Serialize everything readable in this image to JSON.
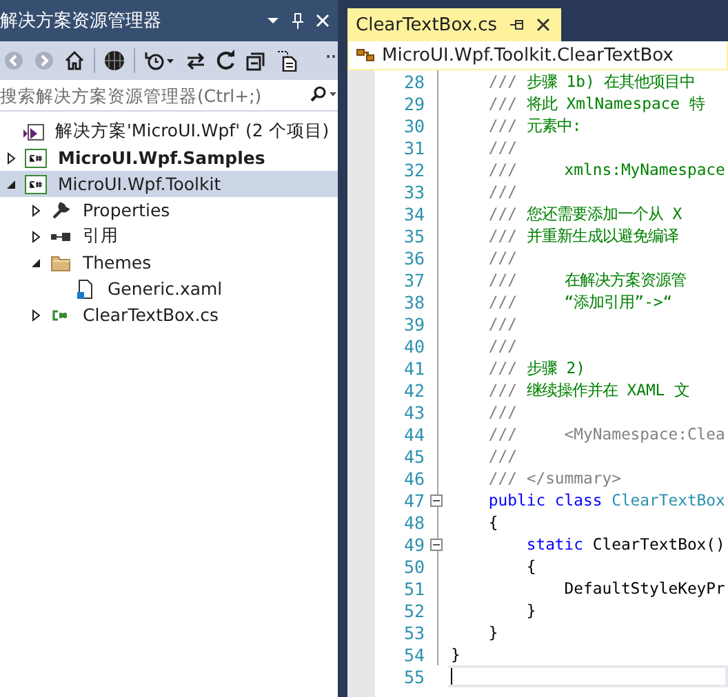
{
  "explorer": {
    "title": "解决方案资源管理器",
    "toolbar": [
      {
        "kind": "back",
        "disabled": true
      },
      {
        "kind": "forward",
        "disabled": true
      },
      {
        "kind": "home",
        "disabled": false
      },
      {
        "kind": "globe",
        "disabled": false
      },
      {
        "kind": "history",
        "disabled": false
      },
      {
        "kind": "sync",
        "disabled": false
      },
      {
        "kind": "refresh",
        "disabled": false
      },
      {
        "kind": "collapse",
        "disabled": false
      },
      {
        "kind": "files",
        "disabled": false
      }
    ],
    "search": {
      "placeholder": "搜索解决方案资源管理器(Ctrl+;)"
    },
    "tree": [
      {
        "kind": "solution",
        "label": "解决方案'MicroUI.Wpf' (2 个项目)",
        "selected": false,
        "children": [
          {
            "kind": "project",
            "label": "MicroUI.Wpf.Samples",
            "startup": true,
            "expanded": false,
            "selected": false
          },
          {
            "kind": "project",
            "label": "MicroUI.Wpf.Toolkit",
            "startup": false,
            "expanded": true,
            "selected": true,
            "children": [
              {
                "kind": "properties",
                "label": "Properties",
                "expanded": false,
                "selected": false
              },
              {
                "kind": "references",
                "label": "引用",
                "expanded": false,
                "selected": false
              },
              {
                "kind": "folder",
                "label": "Themes",
                "expanded": true,
                "selected": false,
                "children": [
                  {
                    "kind": "xaml",
                    "label": "Generic.xaml",
                    "selected": false
                  }
                ]
              },
              {
                "kind": "csharp",
                "label": "ClearTextBox.cs",
                "expanded": false,
                "selected": false
              }
            ]
          }
        ]
      }
    ]
  },
  "editor": {
    "tab": {
      "label": "ClearTextBox.cs",
      "selected": true
    },
    "navigation": "MicroUI.Wpf.Toolkit.ClearTextBox",
    "lines": [
      {
        "number": "28",
        "current": false,
        "segments": [
          {
            "kind": "doc",
            "text": "    ///"
          },
          {
            "kind": "comment",
            "text": " 步骤 1b) 在其他项目中"
          }
        ]
      },
      {
        "number": "29",
        "current": false,
        "segments": [
          {
            "kind": "doc",
            "text": "    ///"
          },
          {
            "kind": "comment",
            "text": " 将此 XmlNamespace 特"
          }
        ]
      },
      {
        "number": "30",
        "current": false,
        "segments": [
          {
            "kind": "doc",
            "text": "    ///"
          },
          {
            "kind": "comment",
            "text": " 元素中:"
          }
        ]
      },
      {
        "number": "31",
        "current": false,
        "segments": [
          {
            "kind": "doc",
            "text": "    ///"
          }
        ]
      },
      {
        "number": "32",
        "current": false,
        "segments": [
          {
            "kind": "doc",
            "text": "    ///"
          },
          {
            "kind": "comment",
            "text": "     xmlns:MyNamespace"
          }
        ]
      },
      {
        "number": "33",
        "current": false,
        "segments": [
          {
            "kind": "doc",
            "text": "    ///"
          }
        ]
      },
      {
        "number": "34",
        "current": false,
        "segments": [
          {
            "kind": "doc",
            "text": "    ///"
          },
          {
            "kind": "comment",
            "text": " 您还需要添加一个从 X"
          }
        ]
      },
      {
        "number": "35",
        "current": false,
        "segments": [
          {
            "kind": "doc",
            "text": "    ///"
          },
          {
            "kind": "comment",
            "text": " 并重新生成以避免编译"
          }
        ]
      },
      {
        "number": "36",
        "current": false,
        "segments": [
          {
            "kind": "doc",
            "text": "    ///"
          }
        ]
      },
      {
        "number": "37",
        "current": false,
        "segments": [
          {
            "kind": "doc",
            "text": "    ///"
          },
          {
            "kind": "comment",
            "text": "     在解决方案资源管"
          }
        ]
      },
      {
        "number": "38",
        "current": false,
        "segments": [
          {
            "kind": "doc",
            "text": "    ///"
          },
          {
            "kind": "comment",
            "text": "     “添加引用”->“"
          }
        ]
      },
      {
        "number": "39",
        "current": false,
        "segments": [
          {
            "kind": "doc",
            "text": "    ///"
          }
        ]
      },
      {
        "number": "40",
        "current": false,
        "segments": [
          {
            "kind": "doc",
            "text": "    ///"
          }
        ]
      },
      {
        "number": "41",
        "current": false,
        "segments": [
          {
            "kind": "doc",
            "text": "    ///"
          },
          {
            "kind": "comment",
            "text": " 步骤 2)"
          }
        ]
      },
      {
        "number": "42",
        "current": false,
        "segments": [
          {
            "kind": "doc",
            "text": "    ///"
          },
          {
            "kind": "comment",
            "text": " 继续操作并在 XAML 文"
          }
        ]
      },
      {
        "number": "43",
        "current": false,
        "segments": [
          {
            "kind": "doc",
            "text": "    ///"
          }
        ]
      },
      {
        "number": "44",
        "current": false,
        "segments": [
          {
            "kind": "doc",
            "text": "    ///     <MyNamespace:Clea"
          }
        ]
      },
      {
        "number": "45",
        "current": false,
        "segments": [
          {
            "kind": "doc",
            "text": "    ///"
          }
        ]
      },
      {
        "number": "46",
        "current": false,
        "segments": [
          {
            "kind": "doc",
            "text": "    /// </summary>"
          }
        ]
      },
      {
        "number": "47",
        "current": false,
        "expanded": true,
        "segments": [
          {
            "kind": "keyword",
            "text": "    public class"
          },
          {
            "kind": "type",
            "text": " ClearTextBox"
          }
        ]
      },
      {
        "number": "48",
        "current": false,
        "segments": [
          {
            "kind": "plain",
            "text": "    {"
          }
        ]
      },
      {
        "number": "49",
        "current": false,
        "expanded": true,
        "segments": [
          {
            "kind": "keyword",
            "text": "        static"
          },
          {
            "kind": "plain",
            "text": " ClearTextBox()"
          }
        ]
      },
      {
        "number": "50",
        "current": false,
        "segments": [
          {
            "kind": "plain",
            "text": "        {"
          }
        ]
      },
      {
        "number": "51",
        "current": false,
        "segments": [
          {
            "kind": "plain",
            "text": "            DefaultStyleKeyPr"
          }
        ]
      },
      {
        "number": "52",
        "current": false,
        "segments": [
          {
            "kind": "plain",
            "text": "        }"
          }
        ]
      },
      {
        "number": "53",
        "current": false,
        "segments": [
          {
            "kind": "plain",
            "text": "    }"
          }
        ]
      },
      {
        "number": "54",
        "current": false,
        "segments": [
          {
            "kind": "plain",
            "text": "}"
          }
        ]
      },
      {
        "number": "55",
        "current": true
      }
    ]
  }
}
